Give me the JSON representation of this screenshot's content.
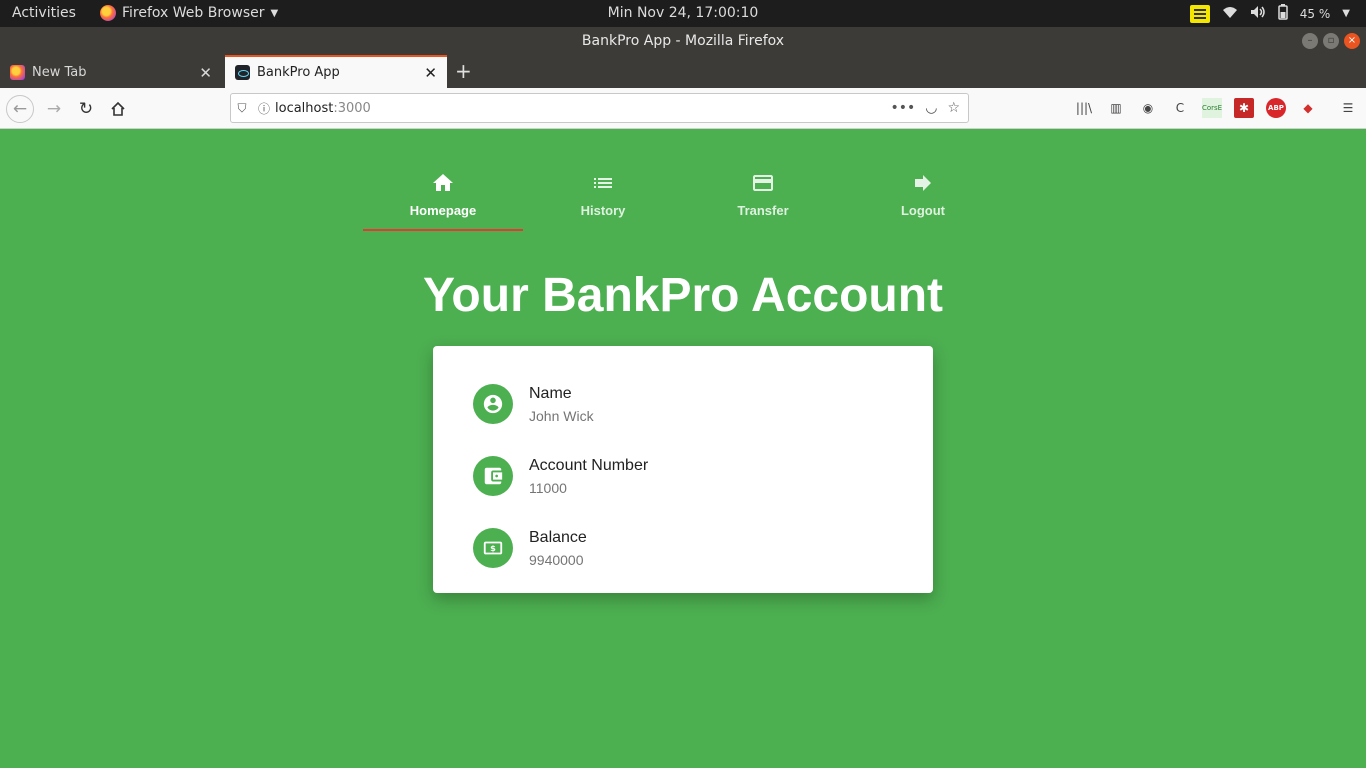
{
  "os_topbar": {
    "activities": "Activities",
    "app_menu": "Firefox Web Browser",
    "clock": "Min Nov 24, 17:00:10",
    "battery": "45 %"
  },
  "window": {
    "title": "BankPro App - Mozilla Firefox"
  },
  "tabs": [
    {
      "label": "New Tab",
      "icon": "firefox-icon",
      "active": false
    },
    {
      "label": "BankPro App",
      "icon": "react-icon",
      "active": true
    }
  ],
  "urlbar": {
    "host": "localhost",
    "port": ":3000"
  },
  "extensions": {
    "cors_label_1": "Cors",
    "cors_label_2": "E",
    "abp_label": "ABP"
  },
  "app": {
    "nav": [
      {
        "label": "Homepage",
        "icon": "home-icon",
        "active": true
      },
      {
        "label": "History",
        "icon": "list-icon",
        "active": false
      },
      {
        "label": "Transfer",
        "icon": "credit-card-icon",
        "active": false
      },
      {
        "label": "Logout",
        "icon": "arrow-right-icon",
        "active": false
      }
    ],
    "title": "Your BankPro Account",
    "account": {
      "name_label": "Name",
      "name_value": "John Wick",
      "number_label": "Account Number",
      "number_value": "11000",
      "balance_label": "Balance",
      "balance_value": "9940000"
    }
  },
  "colors": {
    "background": "#4caf50",
    "active_indicator": "#e53935",
    "card": "#ffffff"
  }
}
